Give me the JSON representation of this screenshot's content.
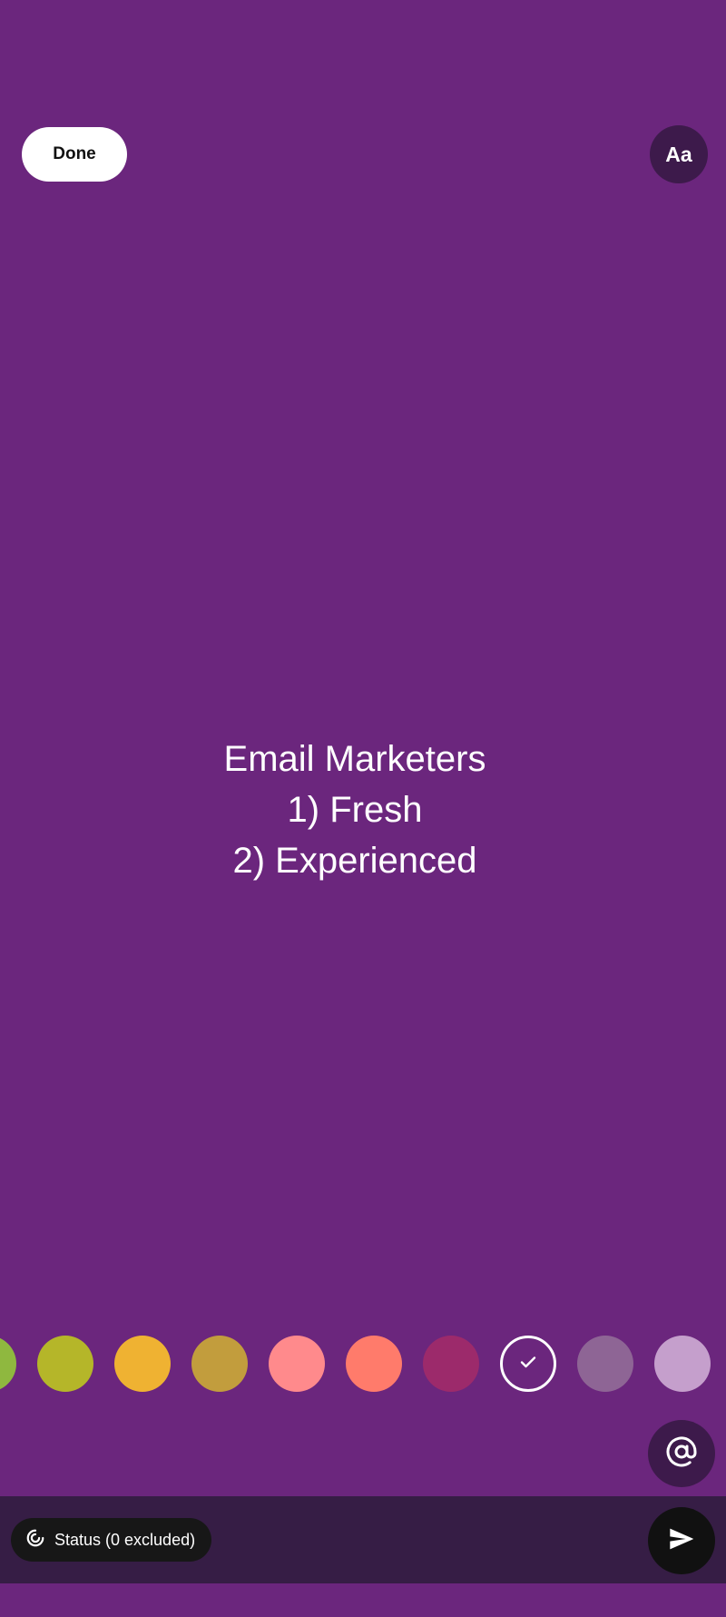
{
  "header": {
    "done_label": "Done",
    "font_toggle_label": "Aa"
  },
  "story": {
    "lines": [
      "Email Marketers",
      "1) Fresh",
      "2) Experienced"
    ]
  },
  "background_color": "#6b267d",
  "color_palette": {
    "swatches": [
      {
        "color": "#8fb83f",
        "selected": false
      },
      {
        "color": "#b5b629",
        "selected": false
      },
      {
        "color": "#efb232",
        "selected": false
      },
      {
        "color": "#c29d3d",
        "selected": false
      },
      {
        "color": "#ff8a8c",
        "selected": false
      },
      {
        "color": "#ff7b6b",
        "selected": false
      },
      {
        "color": "#9c2a6b",
        "selected": false
      },
      {
        "color": "#6b267d",
        "selected": true,
        "icon": "check-icon"
      },
      {
        "color": "#8e6595",
        "selected": false
      },
      {
        "color": "#c59fcc",
        "selected": false
      }
    ]
  },
  "mention": {
    "icon": "at-sign-icon"
  },
  "footer": {
    "status_label": "Status (0 excluded)",
    "status_icon": "status-icon",
    "send_icon": "send-icon"
  }
}
